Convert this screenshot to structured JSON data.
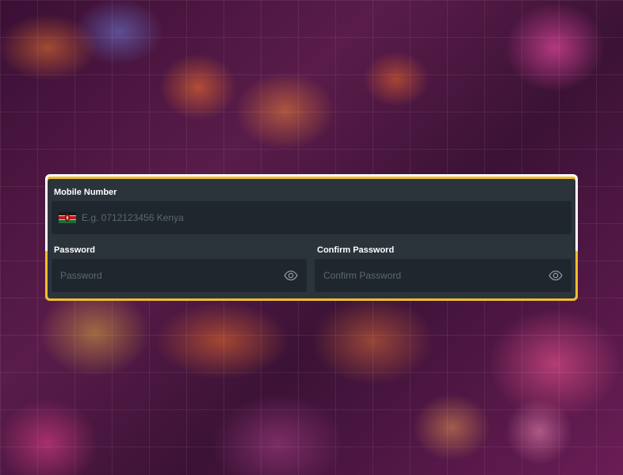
{
  "form": {
    "mobile": {
      "label": "Mobile Number",
      "placeholder": "E.g. 0712123456 Kenya",
      "value": "",
      "flag_icon": "kenya-flag-icon"
    },
    "password": {
      "label": "Password",
      "placeholder": "Password",
      "value": "",
      "toggle_icon": "eye-icon"
    },
    "confirm_password": {
      "label": "Confirm Password",
      "placeholder": "Confirm Password",
      "value": "",
      "toggle_icon": "eye-icon"
    }
  },
  "colors": {
    "panel_background": "#2b333b",
    "field_background": "#1f262d",
    "highlight_border": "#f1be2c",
    "label_text": "#ffffff",
    "placeholder_text": "#5c6873"
  }
}
